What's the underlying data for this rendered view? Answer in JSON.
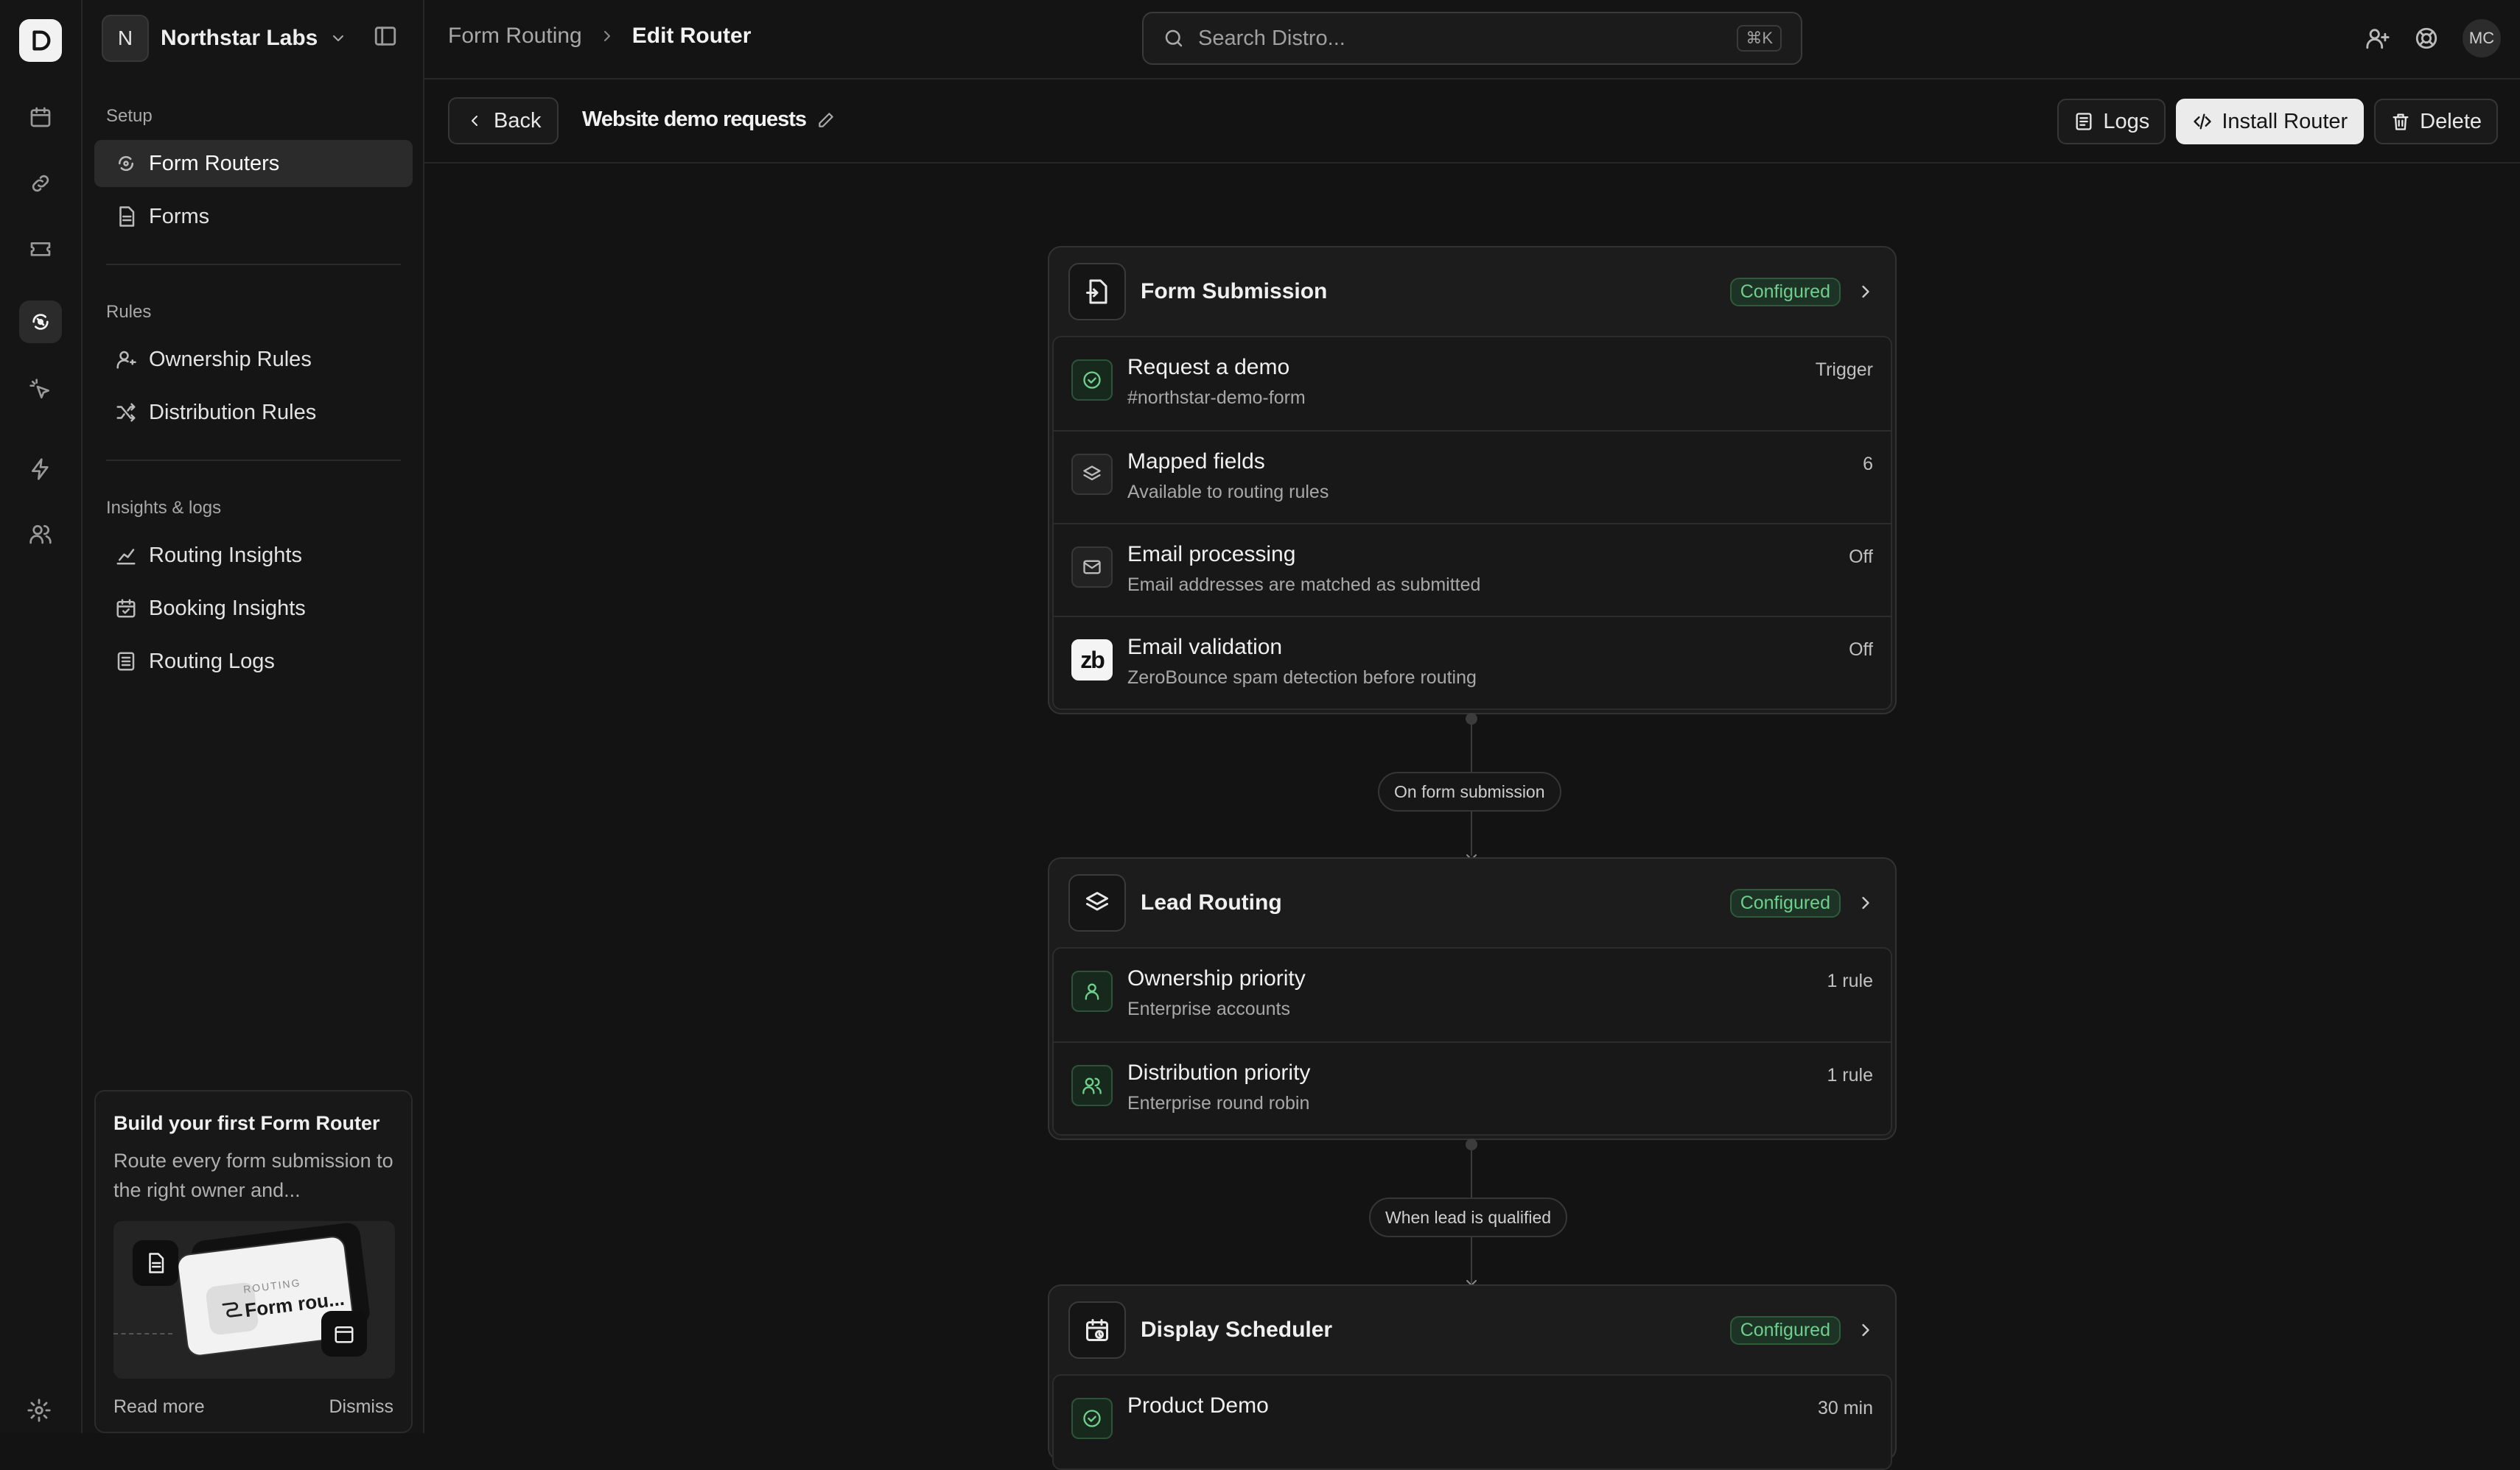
{
  "workspace": {
    "initial": "N",
    "name": "Northstar Labs"
  },
  "breadcrumb": {
    "parent": "Form Routing",
    "current": "Edit Router"
  },
  "search": {
    "placeholder": "Search Distro...",
    "shortcut": "⌘K"
  },
  "user": {
    "initials": "MC"
  },
  "sidebar": {
    "sections": [
      {
        "header": "Setup",
        "items": [
          {
            "label": "Form Routers",
            "icon": "router-icon",
            "active": true
          },
          {
            "label": "Forms",
            "icon": "document-icon"
          }
        ]
      },
      {
        "header": "Rules",
        "items": [
          {
            "label": "Ownership Rules",
            "icon": "user-key-icon"
          },
          {
            "label": "Distribution Rules",
            "icon": "shuffle-icon"
          }
        ]
      },
      {
        "header": "Insights & logs",
        "items": [
          {
            "label": "Routing Insights",
            "icon": "chart-icon"
          },
          {
            "label": "Booking Insights",
            "icon": "calendar-check-icon"
          },
          {
            "label": "Routing Logs",
            "icon": "list-icon"
          }
        ]
      }
    ],
    "promo": {
      "title": "Build your first Form Router",
      "description": "Route every form submission to the right owner and...",
      "image_label": "ROUTING",
      "image_name": "Form rou...",
      "read_more": "Read more",
      "dismiss": "Dismiss"
    }
  },
  "toolbar": {
    "back": "Back",
    "router_name": "Website demo requests",
    "logs": "Logs",
    "install": "Install Router",
    "delete": "Delete"
  },
  "flow": {
    "form_submission": {
      "title": "Form Submission",
      "status": "Configured",
      "rows": [
        {
          "title": "Request a demo",
          "subtitle": "#northstar-demo-form",
          "value": "Trigger",
          "icon": "check-circle-icon"
        },
        {
          "title": "Mapped fields",
          "subtitle": "Available to routing rules",
          "value": "6",
          "icon": "layers-icon"
        },
        {
          "title": "Email processing",
          "subtitle": "Email addresses are matched as submitted",
          "value": "Off",
          "icon": "mail-icon"
        },
        {
          "title": "Email validation",
          "subtitle": "ZeroBounce spam detection before routing",
          "value": "Off",
          "icon": "zerobounce-icon",
          "icon_text": "zb"
        }
      ]
    },
    "connector_1": "On form submission",
    "lead_routing": {
      "title": "Lead Routing",
      "status": "Configured",
      "rows": [
        {
          "title": "Ownership priority",
          "subtitle": "Enterprise accounts",
          "value": "1 rule",
          "icon": "user-icon"
        },
        {
          "title": "Distribution priority",
          "subtitle": "Enterprise round robin",
          "value": "1 rule",
          "icon": "users-icon"
        }
      ]
    },
    "connector_2": "When lead is qualified",
    "display_scheduler": {
      "title": "Display Scheduler",
      "status": "Configured",
      "rows": [
        {
          "title": "Product Demo",
          "subtitle": "",
          "value": "30 min",
          "icon": "check-circle-icon"
        }
      ]
    }
  },
  "colors": {
    "accent_green": "#6fcf8c",
    "background": "#131313"
  }
}
